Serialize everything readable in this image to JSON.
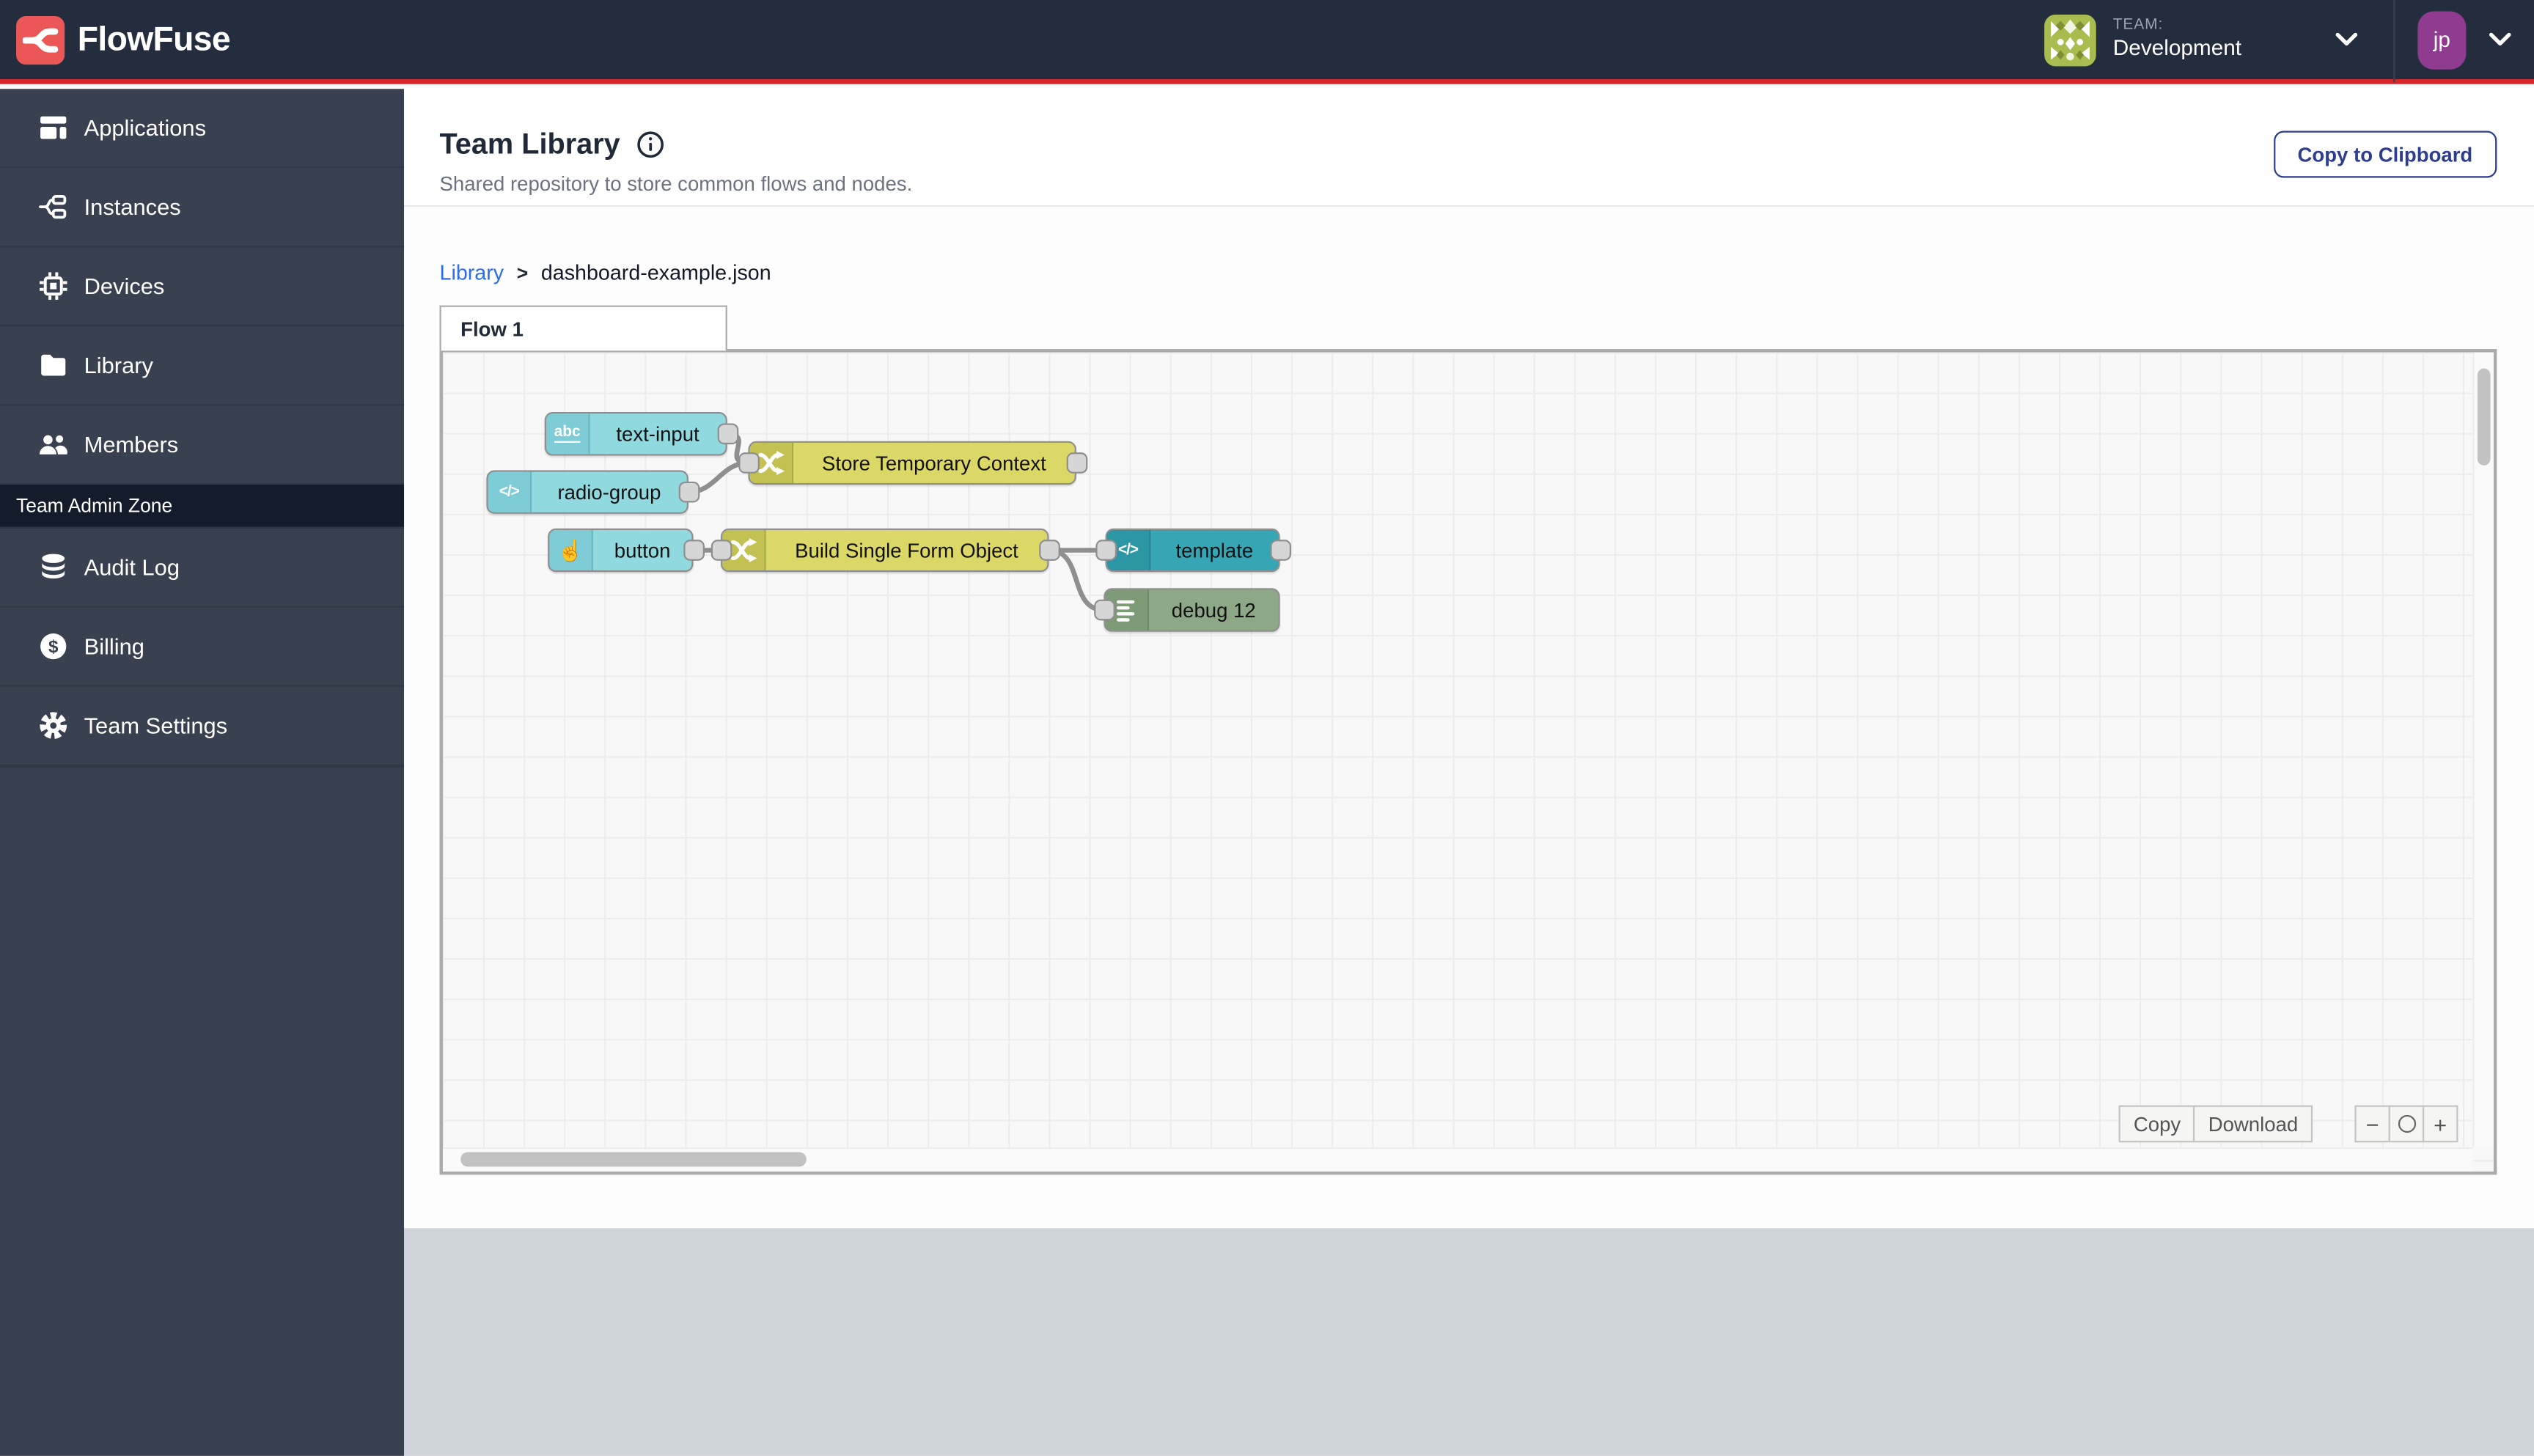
{
  "navbar": {
    "brand": "FlowFuse",
    "team_label": "TEAM:",
    "team_name": "Development",
    "user_initials": "jp"
  },
  "sidebar": {
    "items": [
      {
        "label": "Applications",
        "icon": "applications-icon"
      },
      {
        "label": "Instances",
        "icon": "instances-icon"
      },
      {
        "label": "Devices",
        "icon": "devices-icon"
      },
      {
        "label": "Library",
        "icon": "library-icon"
      },
      {
        "label": "Members",
        "icon": "members-icon"
      }
    ],
    "admin_zone_label": "Team Admin Zone",
    "admin_items": [
      {
        "label": "Audit Log",
        "icon": "database-icon"
      },
      {
        "label": "Billing",
        "icon": "dollar-icon"
      },
      {
        "label": "Team Settings",
        "icon": "gear-icon"
      }
    ]
  },
  "header": {
    "title": "Team Library",
    "subtitle": "Shared repository to store common flows and nodes.",
    "copy_button": "Copy to Clipboard"
  },
  "breadcrumb": {
    "root": "Library",
    "separator": ">",
    "current": "dashboard-example.json"
  },
  "flow": {
    "tab": "Flow 1",
    "nodes": [
      {
        "label": "text-input",
        "type": "ui-text-input",
        "icon": "abc-icon",
        "icon_text": "abc",
        "color": "#8FD9DF"
      },
      {
        "label": "radio-group",
        "type": "ui-radio-group",
        "icon": "code-icon",
        "icon_text": "</>",
        "color": "#8FD9DF"
      },
      {
        "label": "Store Temporary Context",
        "type": "change",
        "icon": "shuffle-icon",
        "color": "#DBD867"
      },
      {
        "label": "button",
        "type": "ui-button",
        "icon": "hand-pointer-icon",
        "icon_text": "☝",
        "color": "#8FD9DF"
      },
      {
        "label": "Build Single Form Object",
        "type": "change",
        "icon": "shuffle-icon",
        "color": "#DBD867"
      },
      {
        "label": "template",
        "type": "ui-template",
        "icon": "code-icon",
        "icon_text": "</>",
        "color": "#36A6B4"
      },
      {
        "label": "debug 12",
        "type": "debug",
        "icon": "list-icon",
        "color": "#8CA886"
      }
    ],
    "wires": [
      {
        "from": "text-input",
        "to": "Store Temporary Context"
      },
      {
        "from": "radio-group",
        "to": "Store Temporary Context"
      },
      {
        "from": "button",
        "to": "Build Single Form Object"
      },
      {
        "from": "Build Single Form Object",
        "to": "template"
      },
      {
        "from": "Build Single Form Object",
        "to": "debug 12"
      }
    ],
    "controls": {
      "copy": "Copy",
      "download": "Download",
      "zoom_out": "−",
      "zoom_in": "+"
    }
  },
  "colors": {
    "navbar_bg": "#232D3D",
    "accent_red": "#D9242C",
    "logo_red": "#EB5757",
    "sidebar_bg": "#394150",
    "admin_zone_bg": "#141B2A",
    "link_blue": "#2B6CEA",
    "button_blue": "#2E3E8F",
    "user_avatar_purple": "#8F3B8F",
    "team_avatar_olive": "#A9BC4F",
    "wire_gray": "#8F8F8F"
  }
}
